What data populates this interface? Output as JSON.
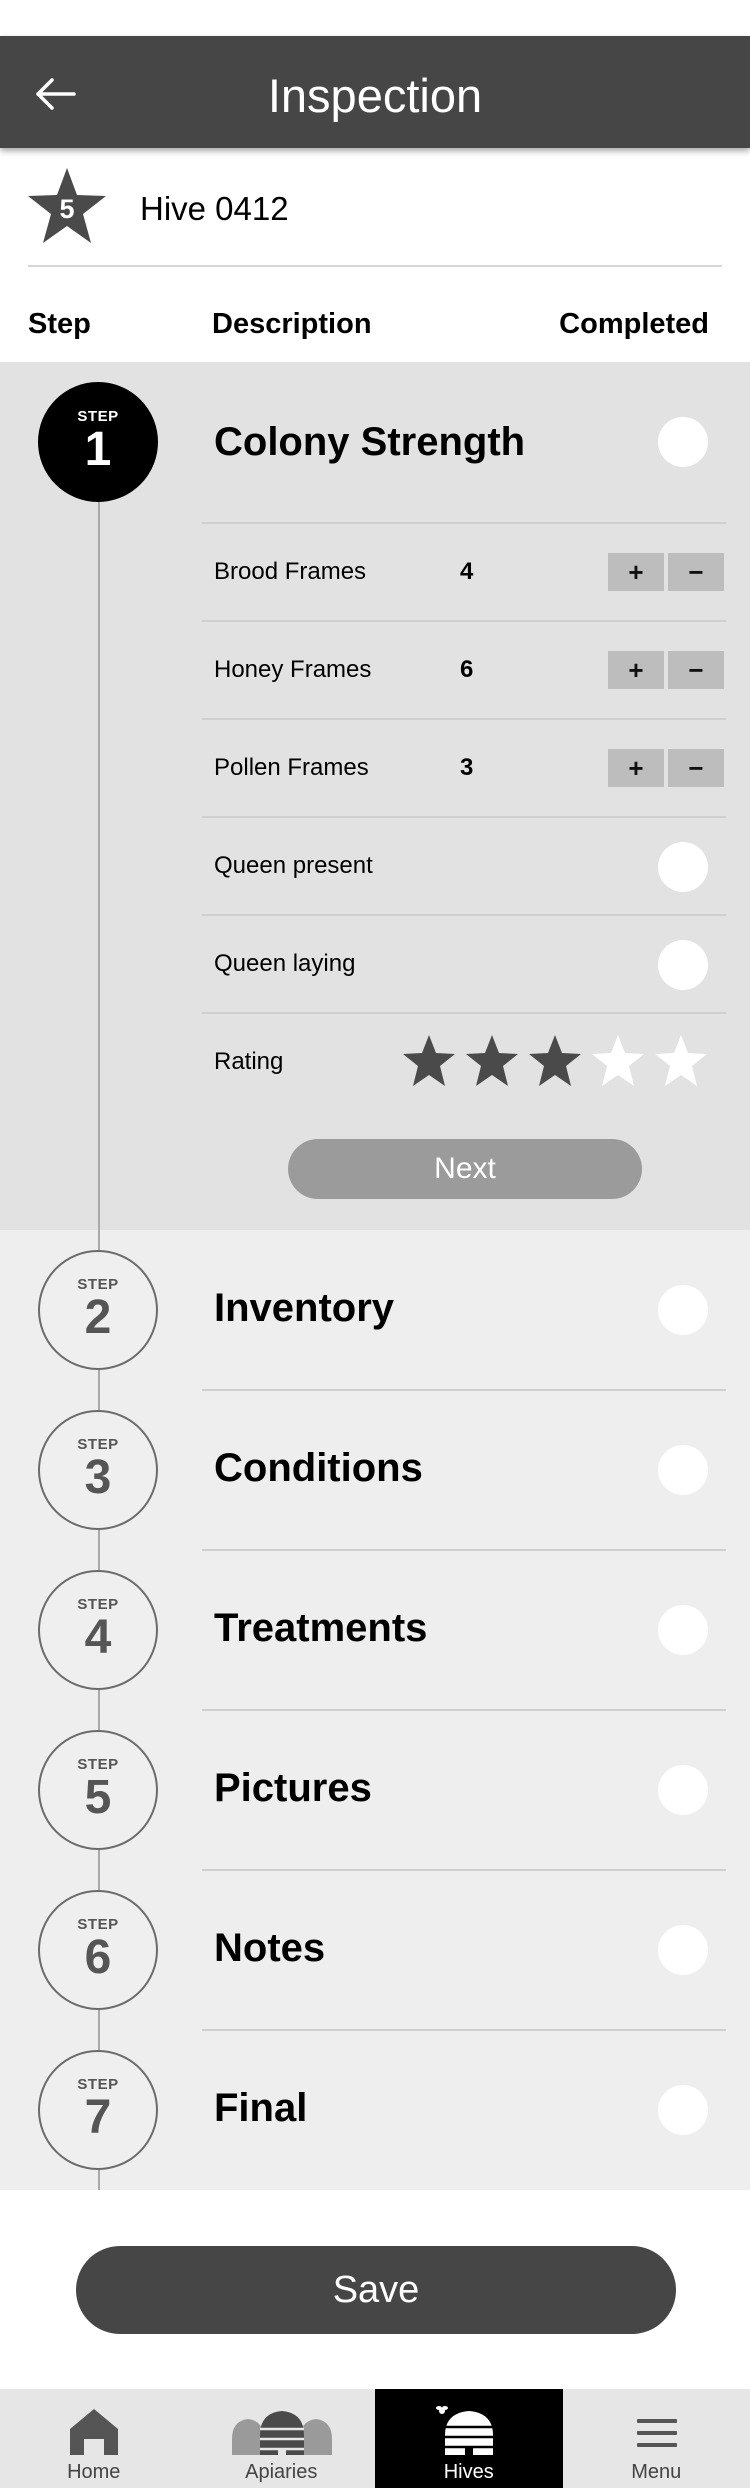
{
  "header": {
    "title": "Inspection",
    "back_icon": "arrow-left-icon"
  },
  "hive": {
    "rating": "5",
    "name": "Hive 0412"
  },
  "columns": {
    "step": "Step",
    "description": "Description",
    "completed": "Completed"
  },
  "step_label": "STEP",
  "steps": [
    {
      "number": "1",
      "title": "Colony Strength",
      "completed": false,
      "active": true
    },
    {
      "number": "2",
      "title": "Inventory",
      "completed": false,
      "active": false
    },
    {
      "number": "3",
      "title": "Conditions",
      "completed": false,
      "active": false
    },
    {
      "number": "4",
      "title": "Treatments",
      "completed": false,
      "active": false
    },
    {
      "number": "5",
      "title": "Pictures",
      "completed": false,
      "active": false
    },
    {
      "number": "6",
      "title": "Notes",
      "completed": false,
      "active": false
    },
    {
      "number": "7",
      "title": "Final",
      "completed": false,
      "active": false
    }
  ],
  "colony": {
    "counters": [
      {
        "label": "Brood Frames",
        "value": "4",
        "plus": "+",
        "minus": "−"
      },
      {
        "label": "Honey Frames",
        "value": "6",
        "plus": "+",
        "minus": "−"
      },
      {
        "label": "Pollen Frames",
        "value": "3",
        "plus": "+",
        "minus": "−"
      }
    ],
    "toggles": [
      {
        "label": "Queen present",
        "checked": false
      },
      {
        "label": "Queen laying",
        "checked": false
      }
    ],
    "rating": {
      "label": "Rating",
      "value": 3,
      "max": 5
    },
    "next_label": "Next"
  },
  "save_label": "Save",
  "nav": {
    "items": [
      {
        "label": "Home",
        "icon": "home-icon",
        "active": false
      },
      {
        "label": "Apiaries",
        "icon": "apiaries-icon",
        "active": false
      },
      {
        "label": "Hives",
        "icon": "hive-icon",
        "active": true
      },
      {
        "label": "Menu",
        "icon": "menu-icon",
        "active": false
      }
    ]
  },
  "colors": {
    "header_bg": "#464646",
    "active_section_bg": "#e2e2e2",
    "section_bg": "#eeeeee",
    "star_filled": "#4a4a4a",
    "star_empty": "#ffffff",
    "next_button": "#9b9b9b",
    "save_button": "#464646",
    "nav_active": "#000000"
  }
}
